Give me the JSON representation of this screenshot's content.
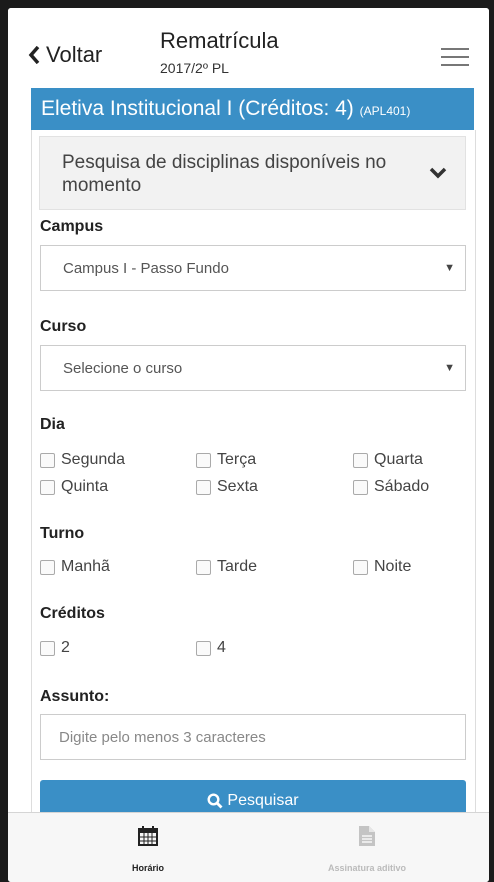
{
  "header": {
    "back_label": "Voltar",
    "title": "Rematrícula",
    "subtitle": "2017/2º PL"
  },
  "panel": {
    "title": "Eletiva Institucional I (Créditos: 4)",
    "code": "(APL401)"
  },
  "search_section": {
    "title": "Pesquisa de disciplinas disponíveis no momento"
  },
  "form": {
    "campus_label": "Campus",
    "campus_value": "Campus I - Passo Fundo",
    "curso_label": "Curso",
    "curso_value": "Selecione o curso",
    "dia_label": "Dia",
    "dias": [
      "Segunda",
      "Terça",
      "Quarta",
      "Quinta",
      "Sexta",
      "Sábado"
    ],
    "turno_label": "Turno",
    "turnos": [
      "Manhã",
      "Tarde",
      "Noite"
    ],
    "creditos_label": "Créditos",
    "creditos": [
      "2",
      "4"
    ],
    "assunto_label": "Assunto:",
    "assunto_placeholder": "Digite pelo menos 3 caracteres",
    "search_button": "Pesquisar"
  },
  "bottom_nav": {
    "tabs": [
      {
        "label": "Horário",
        "icon": "calendar-icon",
        "active": true
      },
      {
        "label": "Assinatura aditivo",
        "icon": "document-icon",
        "active": false
      }
    ]
  },
  "colors": {
    "accent": "#3a8fc6",
    "inactive_tab": "#bbbbbb"
  }
}
